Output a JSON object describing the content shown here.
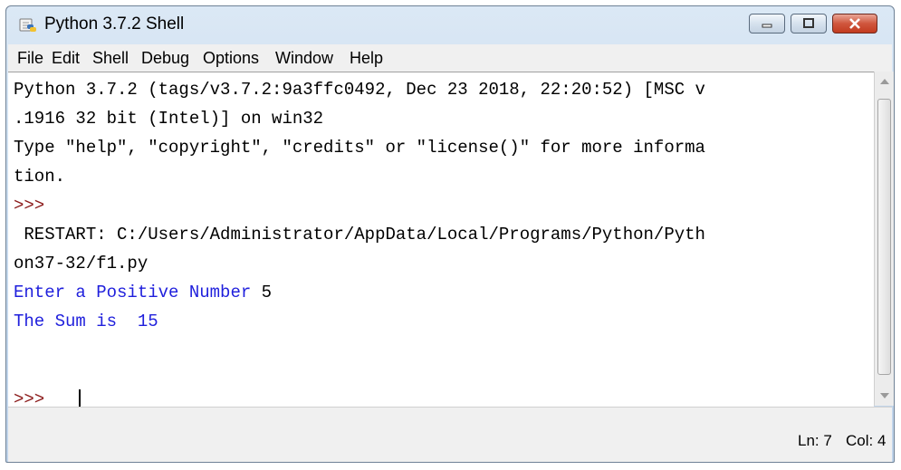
{
  "window": {
    "title": "Python 3.7.2 Shell"
  },
  "menubar": {
    "items": [
      "File",
      "Edit",
      "Shell",
      "Debug",
      "Options",
      "Window",
      "Help"
    ]
  },
  "shell": {
    "lines": [
      "Python 3.7.2 (tags/v3.7.2:9a3ffc0492, Dec 23 2018, 22:20:52) [MSC v",
      ".1916 32 bit (Intel)] on win32",
      "Type \"help\", \"copyright\", \"credits\" or \"license()\" for more informa",
      "tion.",
      ">>> ",
      " RESTART: C:/Users/Administrator/AppData/Local/Programs/Python/Pyth",
      "on37-32/f1.py",
      "Enter a Positive Number ",
      "5",
      "The Sum is  15",
      ">>> "
    ]
  },
  "statusbar": {
    "ln": "Ln: 7",
    "col": "Col: 4"
  },
  "colors": {
    "prompt": "#8b1a1a",
    "output": "#1f1fdc",
    "close_button": "#c23b1f"
  }
}
